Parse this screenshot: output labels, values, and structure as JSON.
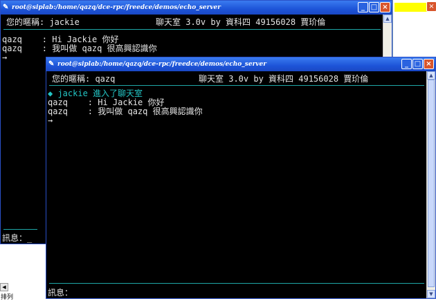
{
  "back_window": {
    "title": "root@siplab:/home/qazq/dce-rpc/freedce/demos/echo_server",
    "nickname_line": "您的暱稱: jackie",
    "header_title": "聊天室 3.0v by 資科四 49156028 賈玠倫",
    "lines": [
      {
        "text": "qazq    : Hi Jackie 你好",
        "style": "normal"
      },
      {
        "text": "qazq    : 我叫做 qazq 很高興認識你",
        "style": "normal"
      },
      {
        "text": "→",
        "style": "normal"
      }
    ],
    "input_label": "訊息：_"
  },
  "front_window": {
    "title": "root@siplab:/home/qazq/dce-rpc/freedce/demos/echo_server",
    "nickname_line": "您的暱稱: qazq",
    "header_title": "聊天室 3.0v by 資科四 49156028 賈玠倫",
    "lines": [
      {
        "text": "◆ jackie 進入了聊天室",
        "style": "cyan"
      },
      {
        "text": "qazq    : Hi Jackie 你好",
        "style": "normal"
      },
      {
        "text": "qazq    : 我叫做 qazq 很高興認識你",
        "style": "normal"
      },
      {
        "text": "→",
        "style": "normal"
      }
    ],
    "input_label": "訊息："
  },
  "window_controls": {
    "minimize": "_",
    "maximize": "□",
    "close": "×"
  },
  "bottom_left_label": "排列",
  "colors": {
    "titlebar": "#1d54d8",
    "terminal_bg": "#000000",
    "separator": "#1ea8a8",
    "cyan_text": "#23c5c5"
  }
}
